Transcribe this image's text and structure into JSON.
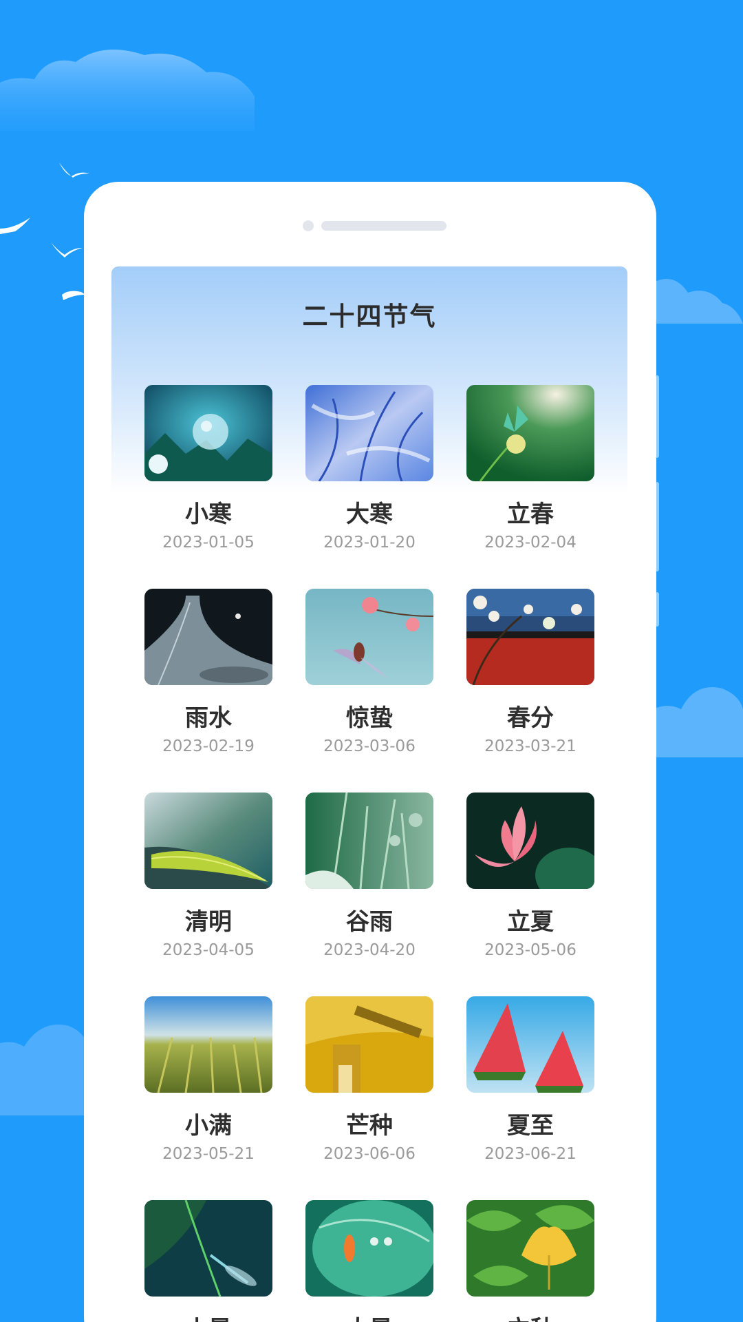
{
  "page": {
    "title": "二十四节气"
  },
  "colors": {
    "background": "#1e9bfb",
    "card": "#ffffff",
    "title": "#2c2c2c",
    "date": "#9a9a9a"
  },
  "solar_terms": [
    {
      "name": "小寒",
      "date": "2023-01-05",
      "image": "ice-bubble-on-pine"
    },
    {
      "name": "大寒",
      "date": "2023-01-20",
      "image": "frosted-blue-branches"
    },
    {
      "name": "立春",
      "date": "2023-02-04",
      "image": "butterfly-on-green"
    },
    {
      "name": "雨水",
      "date": "2023-02-19",
      "image": "water-drop-on-book"
    },
    {
      "name": "惊蛰",
      "date": "2023-03-06",
      "image": "hummingbird-pink-flowers"
    },
    {
      "name": "春分",
      "date": "2023-03-21",
      "image": "blossoms-red-wall"
    },
    {
      "name": "清明",
      "date": "2023-04-05",
      "image": "green-leaf-closeup"
    },
    {
      "name": "谷雨",
      "date": "2023-04-20",
      "image": "dewy-grass"
    },
    {
      "name": "立夏",
      "date": "2023-05-06",
      "image": "pink-lotus"
    },
    {
      "name": "小满",
      "date": "2023-05-21",
      "image": "wheat-field"
    },
    {
      "name": "芒种",
      "date": "2023-06-06",
      "image": "golden-harvest"
    },
    {
      "name": "夏至",
      "date": "2023-06-21",
      "image": "watermelon-slices"
    },
    {
      "name": "小暑",
      "date": "",
      "image": "dragonfly-on-stem"
    },
    {
      "name": "大暑",
      "date": "",
      "image": "goldfish-lotus-leaf"
    },
    {
      "name": "立秋",
      "date": "",
      "image": "ginkgo-leaves"
    }
  ]
}
